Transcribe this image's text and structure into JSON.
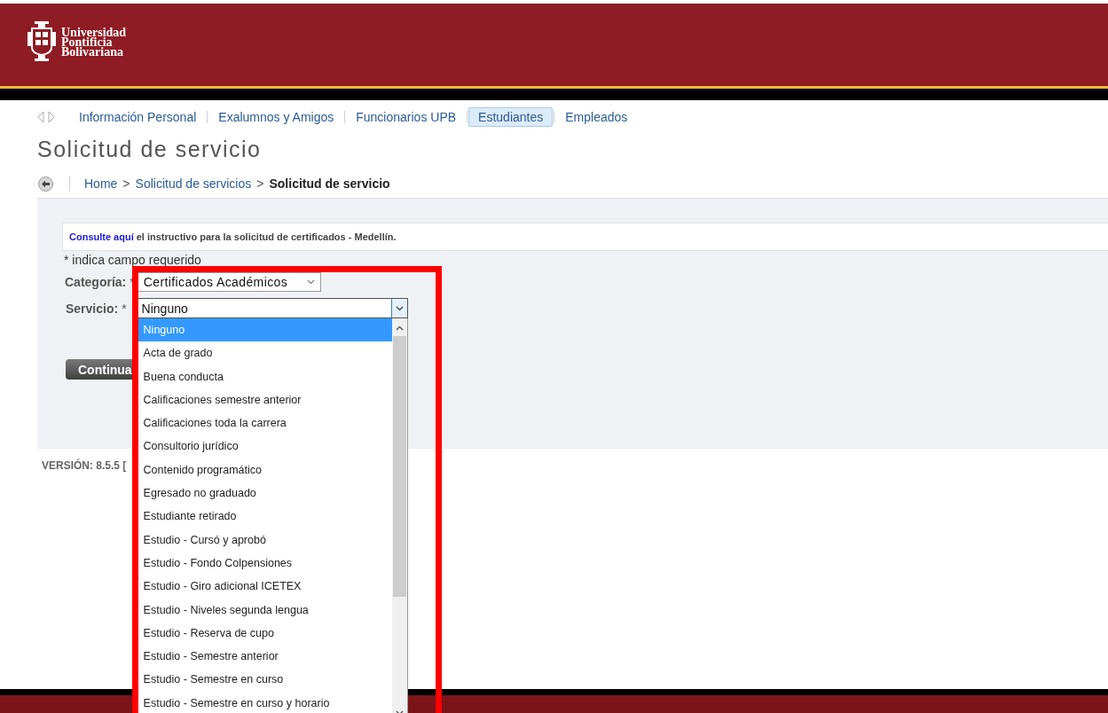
{
  "header": {
    "logo_lines": [
      "Universidad",
      "Pontificia",
      "Bolivariana"
    ]
  },
  "nav": {
    "items": [
      {
        "label": "Información Personal",
        "selected": false
      },
      {
        "label": "Exalumnos y Amigos",
        "selected": false
      },
      {
        "label": "Funcionarios UPB",
        "selected": false
      },
      {
        "label": "Estudiantes",
        "selected": true
      },
      {
        "label": "Empleados",
        "selected": false
      }
    ]
  },
  "page_title": "Solicitud de servicio",
  "breadcrumb": [
    {
      "label": "Home",
      "kind": "link"
    },
    {
      "label": ">",
      "kind": "separator"
    },
    {
      "label": "Solicitud de servicios",
      "kind": "link"
    },
    {
      "label": ">",
      "kind": "separator"
    },
    {
      "label": "Solicitud de servicio",
      "kind": "current"
    }
  ],
  "notice": {
    "link": "Consulte aquí",
    "text": "el instructivo para la solicitud de certificados - Medellín."
  },
  "required_note": "* indica campo requerido",
  "fields": [
    {
      "label": "Categoría:",
      "required_mark": "*",
      "value": "Certificados Académicos",
      "open": false
    },
    {
      "label": "Servicio:",
      "required_mark": "*",
      "value": "Ninguno",
      "open": true,
      "options": [
        {
          "label": "Ninguno",
          "selected": true
        },
        {
          "label": "Acta de grado",
          "selected": false
        },
        {
          "label": "Buena conducta",
          "selected": false
        },
        {
          "label": "Calificaciones semestre anterior",
          "selected": false
        },
        {
          "label": "Calificaciones toda la carrera",
          "selected": false
        },
        {
          "label": "Consultorio jurídico",
          "selected": false
        },
        {
          "label": "Contenido programático",
          "selected": false
        },
        {
          "label": "Egresado no graduado",
          "selected": false
        },
        {
          "label": "Estudiante retirado",
          "selected": false
        },
        {
          "label": "Estudio - Cursó y aprobó",
          "selected": false
        },
        {
          "label": "Estudio - Fondo Colpensiones",
          "selected": false
        },
        {
          "label": "Estudio - Giro adicional ICETEX",
          "selected": false
        },
        {
          "label": "Estudio - Niveles segunda lengua",
          "selected": false
        },
        {
          "label": "Estudio - Reserva de cupo",
          "selected": false
        },
        {
          "label": "Estudio - Semestre anterior",
          "selected": false
        },
        {
          "label": "Estudio - Semestre en curso",
          "selected": false
        },
        {
          "label": "Estudio - Semestre en curso y horario",
          "selected": false
        }
      ]
    }
  ],
  "continue_button": "Continua",
  "version": "VERSIÓN: 8.5.5 ["
}
